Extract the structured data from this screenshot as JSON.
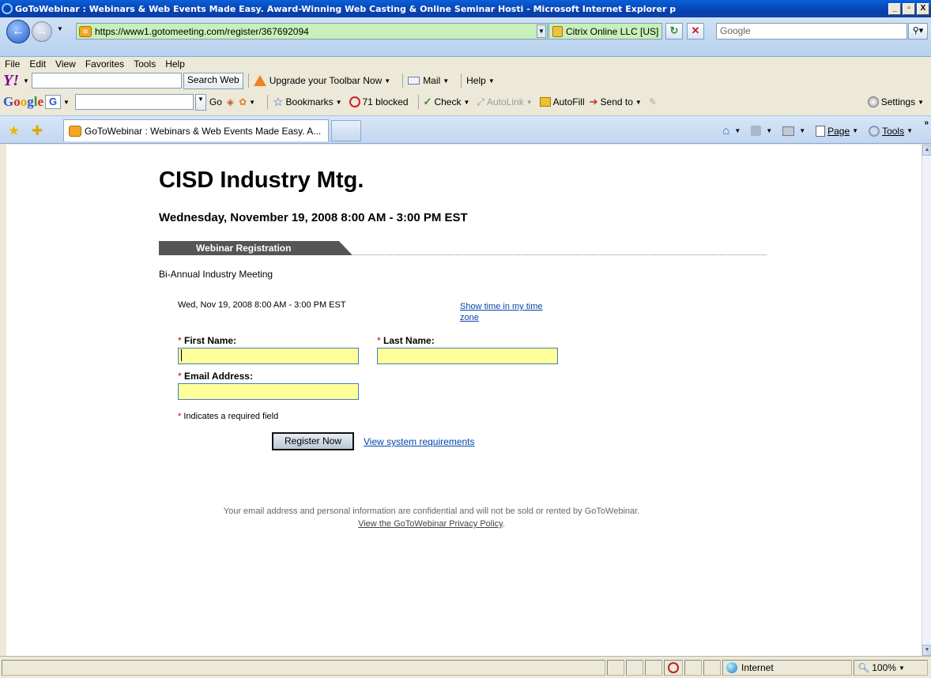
{
  "window": {
    "title": "GoToWebinar : Webinars & Web Events Made Easy. Award-Winning Web Casting & Online Seminar Hosti - Microsoft Internet Explorer p",
    "minimize_label": "_",
    "maximize_label": "▫",
    "close_label": "X"
  },
  "address_bar": {
    "url": "https://www1.gotomeeting.com/register/367692094",
    "cert_label": "Citrix Online LLC [US]",
    "search_value": "Google"
  },
  "menu": [
    "File",
    "Edit",
    "View",
    "Favorites",
    "Tools",
    "Help"
  ],
  "yahoo_toolbar": {
    "search_button": "Search Web",
    "upgrade": "Upgrade your Toolbar Now",
    "mail": "Mail",
    "help": "Help"
  },
  "google_toolbar": {
    "go": "Go",
    "bookmarks": "Bookmarks",
    "blocked": "71 blocked",
    "check": "Check",
    "autolink": "AutoLink",
    "autofill": "AutoFill",
    "send_to": "Send to",
    "settings": "Settings"
  },
  "tabs": [
    {
      "label": "GoToWebinar : Webinars & Web Events Made Easy. A..."
    }
  ],
  "command_bar": {
    "page": "Page",
    "tools": "Tools"
  },
  "page": {
    "title": "CISD Industry Mtg.",
    "date_range": "Wednesday, November 19, 2008 8:00 AM - 3:00 PM EST",
    "section_tab": "Webinar Registration",
    "description": "Bi-Annual Industry Meeting",
    "session_time": "Wed, Nov 19, 2008 8:00 AM - 3:00 PM EST",
    "timezone_link": "Show time in my time zone",
    "first_name_label": "First Name:",
    "last_name_label": "Last Name:",
    "email_label": "Email Address:",
    "required_marker": "*",
    "required_note": "Indicates a required field",
    "register_button": "Register Now",
    "system_requirements_link": "View system requirements",
    "privacy_text": "Your email address and personal information are confidential and will not be sold or rented by GoToWebinar.",
    "privacy_link": "View the GoToWebinar Privacy Policy",
    "first_name_value": "",
    "last_name_value": "",
    "email_value": ""
  },
  "status_bar": {
    "zone": "Internet",
    "zoom": "100%"
  },
  "colors": {
    "input_background": "#FFFF99",
    "link": "#0645AD",
    "required": "#C00000",
    "secure_address_bar": "#C8F0B8"
  }
}
